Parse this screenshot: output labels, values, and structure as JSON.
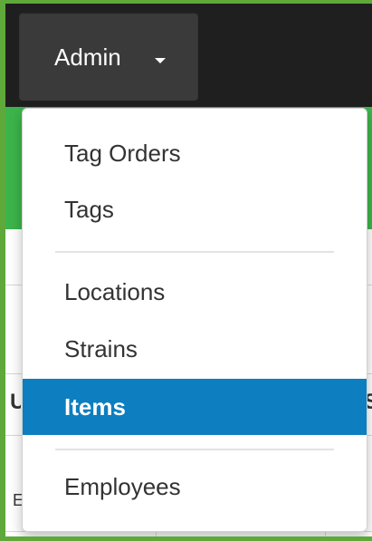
{
  "navbar": {
    "admin_menu": {
      "label": "Admin",
      "caret_icon": "caret-down-icon"
    }
  },
  "dropdown": {
    "groups": [
      {
        "items": [
          {
            "label": "Tag Orders",
            "active": false
          },
          {
            "label": "Tags",
            "active": false
          }
        ]
      },
      {
        "items": [
          {
            "label": "Locations",
            "active": false
          },
          {
            "label": "Strains",
            "active": false
          },
          {
            "label": "Items",
            "active": true
          }
        ]
      },
      {
        "items": [
          {
            "label": "Employees",
            "active": false
          }
        ]
      }
    ]
  },
  "page": {
    "table": {
      "header_left_fragment": "U",
      "header_right_fragment": "S",
      "cell_left_fragment": "E"
    }
  },
  "colors": {
    "frame_green": "#5fa83a",
    "navbar_bg": "#1f1f1f",
    "toggle_bg": "#3a3a3a",
    "green_bar": "#3cb44b",
    "active_item_bg": "#0d7ebf"
  }
}
